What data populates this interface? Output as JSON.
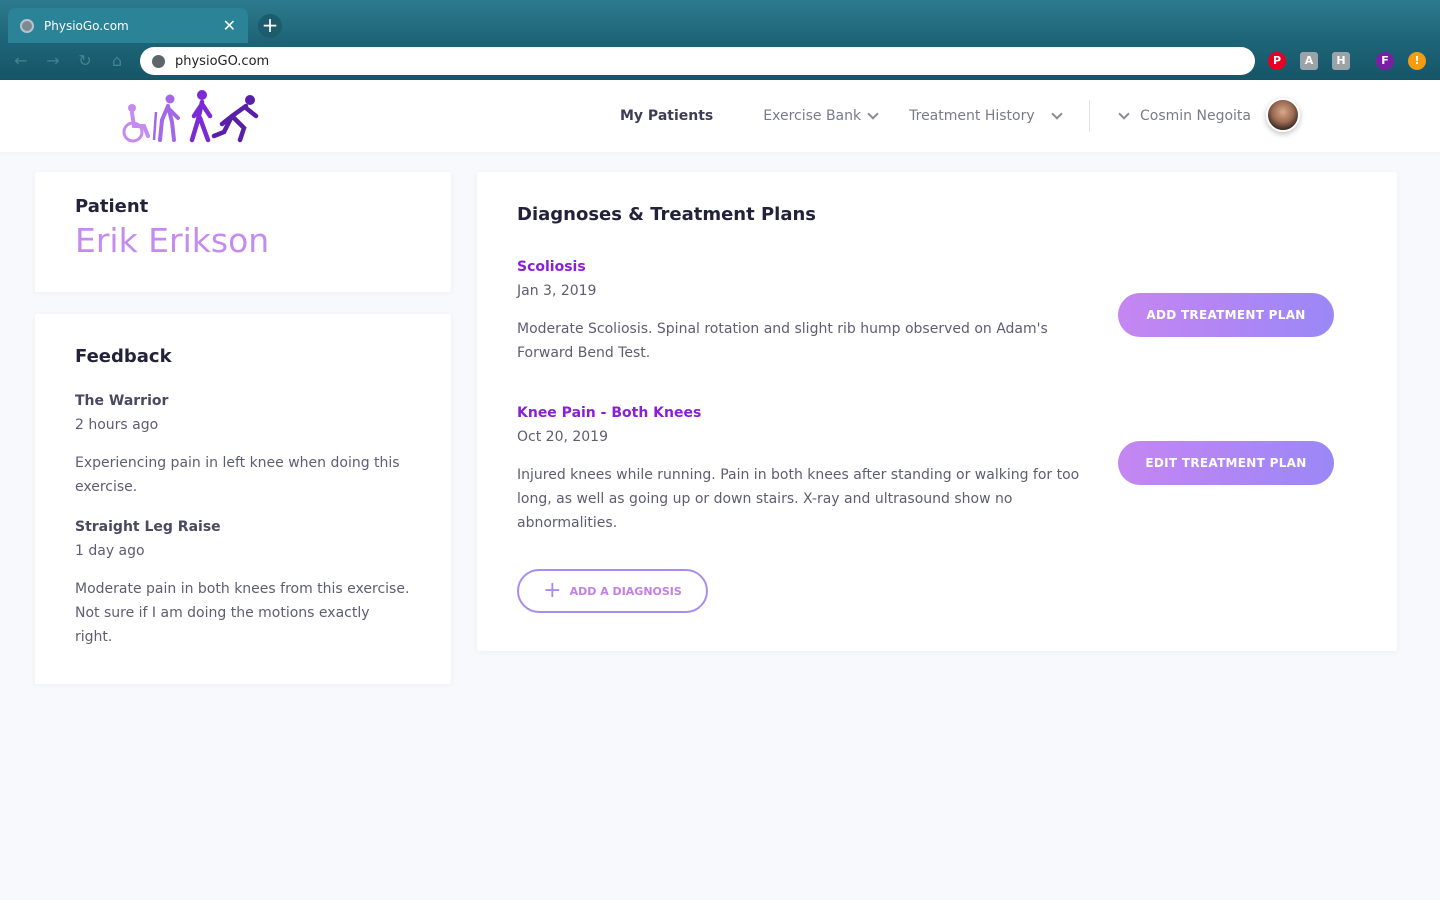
{
  "browser": {
    "tab_title": "PhysioGo.com",
    "close_glyph": "✕",
    "newtab_glyph": "+",
    "url": "physioGO.com",
    "extensions": [
      {
        "icon": "pinterest-icon",
        "label": "P",
        "color": "#e60023"
      },
      {
        "icon": "extension-icon-1",
        "label": "A",
        "color": "#9aa4a8"
      },
      {
        "icon": "extension-icon-2",
        "label": "H",
        "color": "#9aa4a8"
      },
      {
        "icon": "profile-icon",
        "label": "F",
        "color": "#7b1fa2"
      },
      {
        "icon": "alert-icon",
        "label": "!",
        "color": "#f39c12"
      }
    ]
  },
  "nav": {
    "my_patients": "My Patients",
    "exercise_bank": "Exercise Bank",
    "treatment_history": "Treatment History",
    "user_name": "Cosmin Negoita"
  },
  "patient": {
    "label": "Patient",
    "name": "Erik Erikson"
  },
  "feedback": {
    "heading": "Feedback",
    "items": [
      {
        "title": "The Warrior",
        "time": "2 hours ago",
        "text": "Experiencing pain in left knee when doing this exercise."
      },
      {
        "title": "Straight Leg Raise",
        "time": "1 day ago",
        "text": "Moderate pain in both knees from this exercise. Not sure if I am doing the motions exactly right."
      }
    ]
  },
  "diagnoses": {
    "heading": "Diagnoses & Treatment Plans",
    "items": [
      {
        "name": "Scoliosis",
        "date": "Jan 3, 2019",
        "text": "Moderate Scoliosis. Spinal rotation and slight rib hump observed on Adam's Forward Bend Test.",
        "button": "ADD TREATMENT PLAN"
      },
      {
        "name": "Knee Pain - Both Knees",
        "date": "Oct 20, 2019",
        "text": "Injured knees while running. Pain in both knees after standing or walking for too long, as well as going up or down stairs. X-ray and ultrasound show no abnormalities.",
        "button": "EDIT TREATMENT PLAN"
      }
    ],
    "add_label": "ADD A DIAGNOSIS"
  },
  "colors": {
    "accent": "#8a1fd6",
    "patient_name": "#c58bf0",
    "button_gradient_start": "#c586f2",
    "button_gradient_end": "#9b87f7"
  }
}
